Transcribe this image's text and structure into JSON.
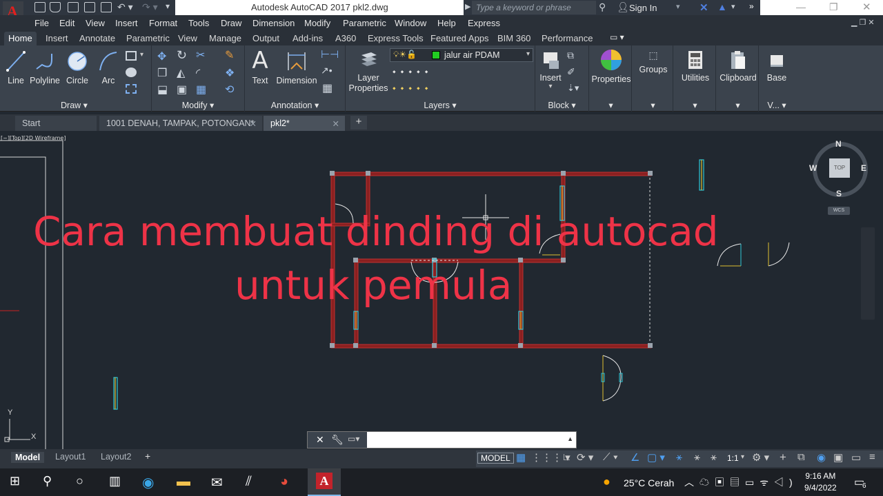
{
  "window": {
    "title": "Autodesk AutoCAD 2017    pkl2.dwg",
    "search_placeholder": "Type a keyword or phrase",
    "sign_in": "Sign In"
  },
  "menubar": [
    "File",
    "Edit",
    "View",
    "Insert",
    "Format",
    "Tools",
    "Draw",
    "Dimension",
    "Modify",
    "Parametric",
    "Window",
    "Help",
    "Express"
  ],
  "ribbon_tabs": [
    "Home",
    "Insert",
    "Annotate",
    "Parametric",
    "View",
    "Manage",
    "Output",
    "Add-ins",
    "A360",
    "Express Tools",
    "Featured Apps",
    "BIM 360",
    "Performance"
  ],
  "ribbon": {
    "draw": {
      "title": "Draw",
      "line": "Line",
      "polyline": "Polyline",
      "circle": "Circle",
      "arc": "Arc"
    },
    "modify": {
      "title": "Modify"
    },
    "annotation": {
      "title": "Annotation",
      "text": "Text",
      "dimension": "Dimension"
    },
    "layers": {
      "title": "Layers",
      "layer_properties_1": "Layer",
      "layer_properties_2": "Properties",
      "current_layer": "jalur air PDAM",
      "layer_color": "#22cc22"
    },
    "block": {
      "title": "Block",
      "insert": "Insert"
    },
    "properties": "Properties",
    "groups": "Groups",
    "utilities": "Utilities",
    "clipboard": "Clipboard",
    "base": "Base",
    "view_short": "V..."
  },
  "doc_tabs": [
    "Start",
    "1001 DENAH, TAMPAK, POTONGAN*",
    "pkl2*"
  ],
  "viewport_label": "[−][Top][2D Wireframe]",
  "viewcube": {
    "n": "N",
    "s": "S",
    "e": "E",
    "w": "W",
    "top": "TOP",
    "wcs": "WCS"
  },
  "overlay": {
    "line1": "Cara membuat dinding di autocad",
    "line2": "untuk pemula"
  },
  "ucs": {
    "x": "X",
    "y": "Y"
  },
  "layout_tabs": [
    "Model",
    "Layout1",
    "Layout2"
  ],
  "status": {
    "model": "MODEL",
    "scale": "1:1"
  },
  "taskbar": {
    "weather": "25°C  Cerah",
    "time": "9:16 AM",
    "date": "9/4/2022",
    "notifications": "6"
  }
}
